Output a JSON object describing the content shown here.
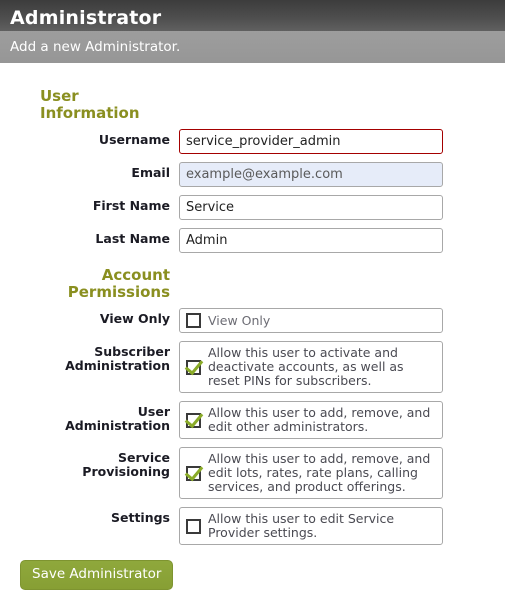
{
  "header": {
    "title": "Administrator",
    "subtitle": "Add a new Administrator."
  },
  "sections": {
    "user_information": {
      "heading": "User Information",
      "fields": [
        {
          "label": "Username",
          "value": "service_provider_admin",
          "state": "error"
        },
        {
          "label": "Email",
          "value": "example@example.com",
          "state": "autofill"
        },
        {
          "label": "First Name",
          "value": "Service",
          "state": "normal"
        },
        {
          "label": "Last Name",
          "value": "Admin",
          "state": "normal"
        }
      ]
    },
    "account_permissions": {
      "heading": "Account Permissions",
      "heading_line1": "Account",
      "heading_line2": "Permissions",
      "items": [
        {
          "label": "View Only",
          "label_line1": "View Only",
          "description": "View Only",
          "checked": false
        },
        {
          "label": "Subscriber Administration",
          "label_line1": "Subscriber",
          "label_line2": "Administration",
          "description": "Allow this user to activate and deactivate accounts, as well as reset PINs for subscribers.",
          "checked": true
        },
        {
          "label": "User Administration",
          "label_line1": "User Administration",
          "description": "Allow this user to add, remove, and edit other administrators.",
          "checked": true
        },
        {
          "label": "Service Provisioning",
          "label_line1": "Service Provisioning",
          "description": "Allow this user to add, remove, and edit lots, rates, rate plans, calling services, and product offerings.",
          "checked": true
        },
        {
          "label": "Settings",
          "label_line1": "Settings",
          "description": "Allow this user to edit Service Provider settings.",
          "checked": false
        }
      ]
    }
  },
  "actions": {
    "save_label": "Save Administrator"
  },
  "colors": {
    "accent_olive": "#8a8f20",
    "button_green": "#8fa83c",
    "error_border": "#a40000",
    "autofill_bg": "#e6ecf9",
    "titlebar": "#4d4d4d",
    "subbar": "#9a9a9a"
  }
}
